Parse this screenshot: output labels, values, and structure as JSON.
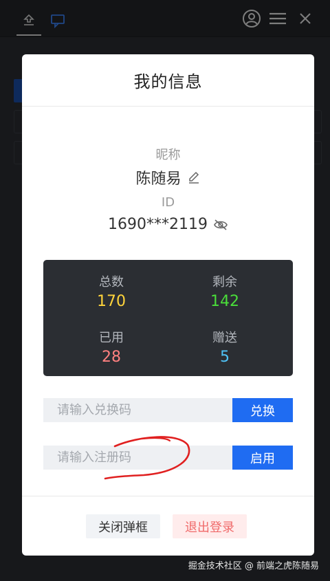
{
  "modal": {
    "title": "我的信息",
    "nickname_label": "昵称",
    "nickname": "陈随易",
    "id_label": "ID",
    "id_value": "1690***2119",
    "stats": [
      {
        "label": "总数",
        "value": "170",
        "color": "#ffd43b"
      },
      {
        "label": "剩余",
        "value": "142",
        "color": "#4ade3a"
      },
      {
        "label": "已用",
        "value": "28",
        "color": "#ff8080"
      },
      {
        "label": "赠送",
        "value": "5",
        "color": "#4fc3f7"
      }
    ],
    "redeem": {
      "placeholder": "请输入兑换码",
      "button": "兑换"
    },
    "register": {
      "placeholder": "请输入注册码",
      "button": "启用"
    },
    "close_button": "关闭弹框",
    "logout_button": "退出登录"
  },
  "watermark": "掘金技术社区 @ 前端之虎陈随易",
  "colors": {
    "primary": "#1f6cf2",
    "annotation": "#e02020"
  }
}
